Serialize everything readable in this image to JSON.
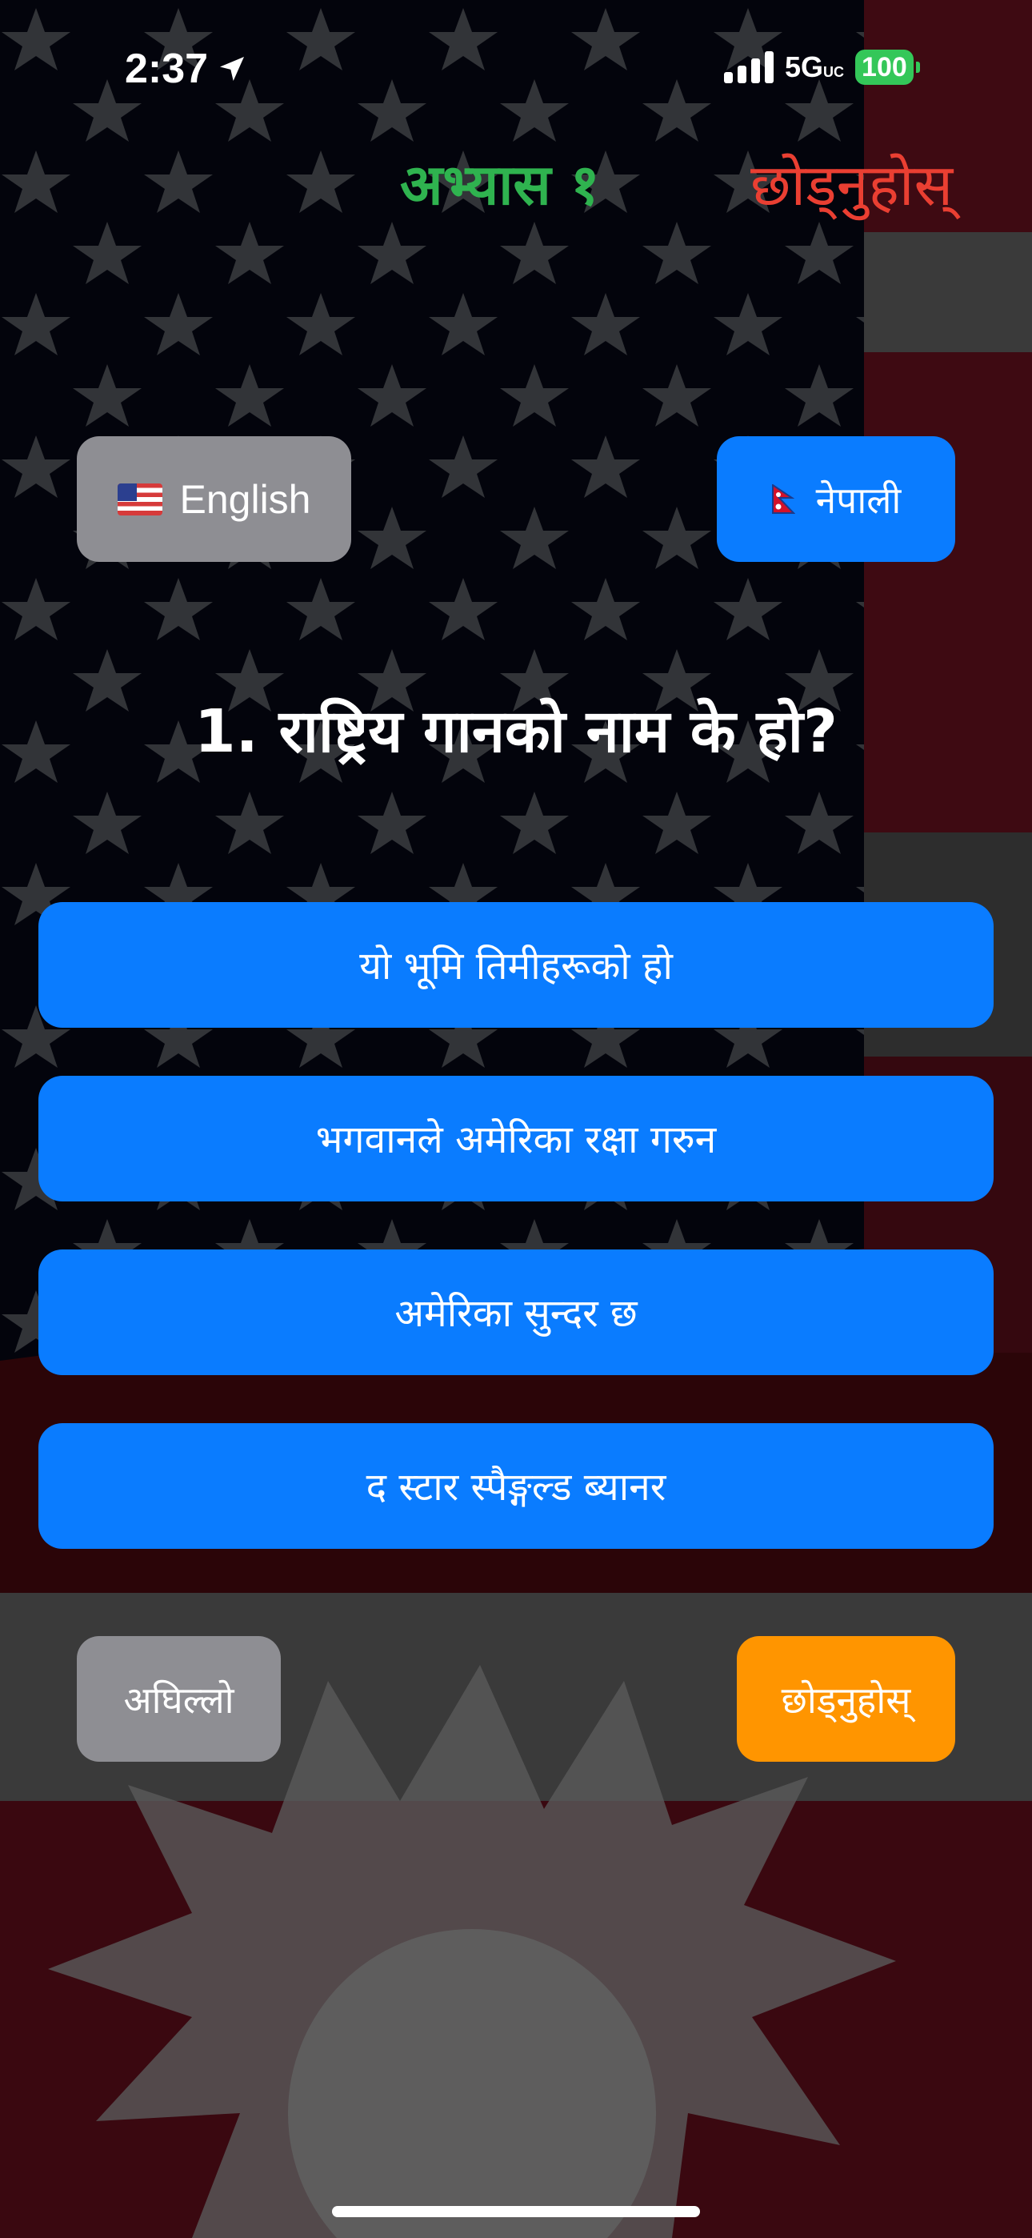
{
  "status_bar": {
    "time": "2:37",
    "network": "5G",
    "network_suffix": "UC",
    "battery": "100"
  },
  "header": {
    "title": "अभ्यास १",
    "quit_label": "छोड्नुहोस्"
  },
  "language_buttons": {
    "english": "English",
    "nepali": "नेपाली"
  },
  "question": {
    "text": "1. राष्ट्रिय गानको नाम के हो?"
  },
  "answers": [
    "यो भूमि तिमीहरूको हो",
    "भगवानले अमेरिका रक्षा गरुन",
    "अमेरिका सुन्दर छ",
    "द स्टार स्पैङ्गल्ड ब्यानर"
  ],
  "navigation": {
    "previous_label": "अघिल्लो",
    "skip_label": "छोड्नुहोस्"
  },
  "colors": {
    "title_green": "#2fb34f",
    "quit_red": "#ea3f32",
    "button_blue": "#0a7cff",
    "button_gray": "#8e8e93",
    "button_orange": "#ff9500",
    "battery_green": "#34c759"
  },
  "icons": {
    "location": "location-arrow-icon",
    "signal": "cellular-signal-icon",
    "battery": "battery-icon",
    "us_flag": "us-flag-icon",
    "nepal_flag": "nepal-flag-icon"
  }
}
